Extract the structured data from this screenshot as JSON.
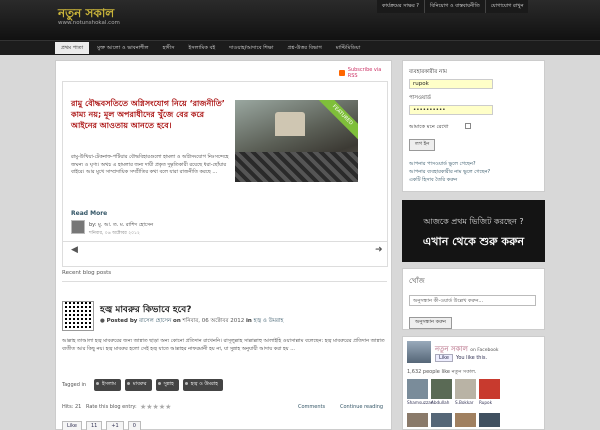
{
  "header": {
    "title": "নতুন সকাল",
    "subtitle": "www.notunshokal.com",
    "toplinks": [
      "কার্যক্রমের সাক্ষর ?",
      "বিনিয়োগ ও বাস্তবায়নীতি",
      "যোগাযোগ রাখুন"
    ]
  },
  "nav": {
    "items": [
      "প্রথম পাতা",
      "মুক্ত আলো ও ভাবনাশীল",
      "হাদীস",
      "ইসলামিক বই",
      "দাওয়াহ/আদাবে শিক্ষা",
      "প্রশ্ন-উত্তর বিভাগ",
      "মাল্টিমিডিয়া"
    ]
  },
  "main": {
    "rss": "Subscribe via RSS",
    "featured": {
      "title": "রামু বৌদ্ধবসতিতে অগ্নিসংযোগ নিয়ে ‘রাজনীতি’ কাম্য নয়; মূল অপরাধীদের খুঁজে বের করে আইনের আওতায় আনতে হবে।",
      "ribbon": "FEATURED",
      "body": "রামু-উখিয়া-টেকনাফ-পটিয়ার বৌদ্ধবিহারগুলো হামলা ও অগ্নিসংযোগ নিঃসন্দেহে জঘন্য ও ঘৃণ্য। অথচ এ হামলার জন্য দায়ী প্রকৃত দুষ্কৃতিকারী রয়েছে ধরা-ছোঁয়ার বাইরে। আর মুখে সাম্প্রদায়িক সম্প্রীতির কথা বলে যারা রাজনীতি করছে ...",
      "readmore": "Read More",
      "author": "by: মু. আ. ত. ম. রাশিদ হোসেন",
      "author_sub": "শনিবার, ০৬ অক্টোবর ২০১২"
    },
    "recent_label": "Recent blog posts",
    "post": {
      "title": "হজ্ব মাবরুর কিভাবে হবে?",
      "posted_by": "Posted by",
      "author": "রাসেল হোসেন",
      "on": "on",
      "date": "শনিবার, 06 অক্টোবর 2012",
      "in": "in",
      "category": "হজ্ব ও উমরাহ",
      "body": "আল্লাহ তাআলা হজ্ব মাবরুরের জন্য জান্নাত ছাড়া অন্য কোনো প্রতিদান রাখেননি। রাসূলুল্লাহ সাল্লাল্লাহু আলাইহি ওয়াসাল্লাম বলেছেন: হজ্ব মাবরুরের প্রতিদান জান্নাত ব্যতীত আর কিছু নয়। হজ্ব মাবরুর হলো সেই হজ্ব যাতে আল্লাহর নাফরমানী হয় না, যা সুন্নাহ অনুযায়ী আদায় করা হয় ..."
    },
    "tags": {
      "label": "Tagged in",
      "items": [
        "ইসলাম",
        "মাবরুর",
        "সুন্নাহ",
        "হজ্ব ও উমরাহ"
      ]
    },
    "footer": {
      "hits": "Hits: 21",
      "rate": "Rate this blog entry:",
      "stars": "★★★★★",
      "comments": "Comments",
      "continue": "Continue reading",
      "like": "Like",
      "like_count": "11",
      "plus": "+1",
      "plus_count": "0"
    }
  },
  "sidebar": {
    "login": {
      "user_label": "ব্যবহারকারীর নাম",
      "user_value": "rupok",
      "pass_label": "পাসওয়ার্ড",
      "pass_value": "••••••••••",
      "remember": "আমাকে মনে রেখো",
      "button": "লগ ইন",
      "links": [
        "আপনার পাসওয়ার্ড ভুলে গেছেন?",
        "আপনার ব্যবহারকারীর নাম ভুলে গেছেন?",
        "একটি হিসাব তৈরি করুন"
      ]
    },
    "banner": {
      "line1": "আজকে প্রথম ভিজিট করছেন ?",
      "line2": "এখান থেকে শুরু করুন"
    },
    "search": {
      "title": "খোঁজ",
      "placeholder": "অনুসন্ধান কী-ওয়ার্ড উল্লেখ করুন...",
      "button": "অনুসন্ধান করুন"
    },
    "facebook": {
      "name": "নতুন সকাল",
      "on": "on Facebook",
      "like": "Like",
      "you_like": "You like this.",
      "count": "1,632 people like নতুন সকাল.",
      "faces": [
        "Shamsuzzan",
        "Abdullah",
        "S.Bokkar",
        "Rupok"
      ]
    }
  }
}
